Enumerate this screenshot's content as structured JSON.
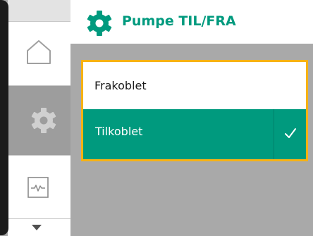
{
  "header": {
    "title": "Pumpe TIL/FRA",
    "icon": "gear-icon"
  },
  "menu": {
    "items": [
      {
        "name": "home",
        "icon": "home-icon"
      },
      {
        "name": "settings",
        "icon": "gear-icon",
        "active": true
      },
      {
        "name": "monitor",
        "icon": "monitor-icon"
      },
      {
        "name": "more",
        "icon": "chevron-down-icon"
      }
    ]
  },
  "options": [
    {
      "label": "Frakoblet",
      "selected": false
    },
    {
      "label": "Tilkoblet",
      "selected": true
    }
  ],
  "colors": {
    "accent": "#009a7e",
    "focus": "#f7b213",
    "background": "#a9a9a9"
  }
}
